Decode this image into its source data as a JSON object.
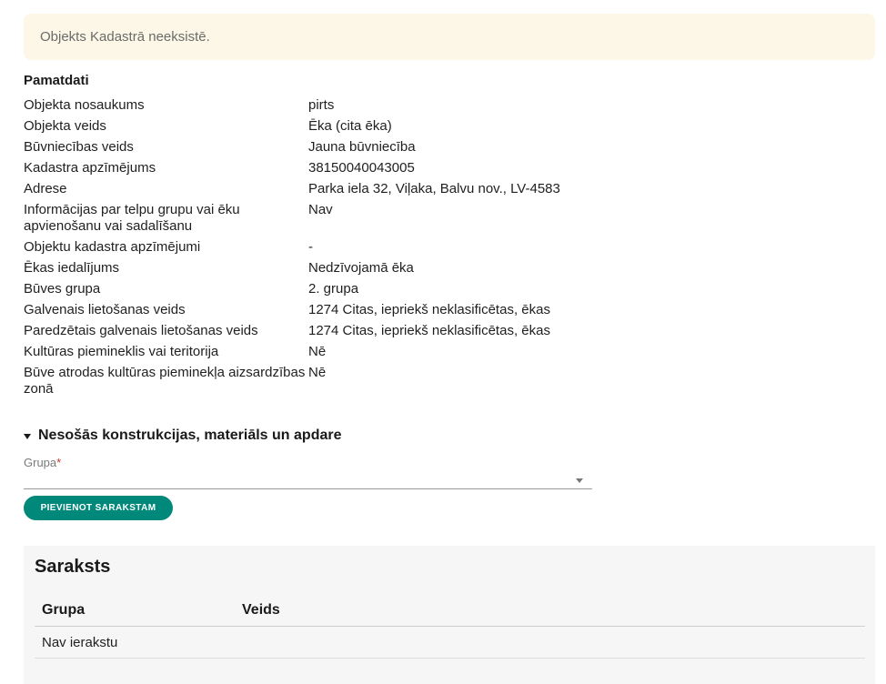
{
  "alert": {
    "message": "Objekts Kadastrā neeksistē."
  },
  "basic": {
    "title": "Pamatdati",
    "rows": [
      {
        "label": "Objekta nosaukums",
        "value": "pirts"
      },
      {
        "label": "Objekta veids",
        "value": "Ēka (cita ēka)"
      },
      {
        "label": "Būvniecības veids",
        "value": "Jauna būvniecība"
      },
      {
        "label": "Kadastra apzīmējums",
        "value": "38150040043005"
      },
      {
        "label": "Adrese",
        "value": "Parka iela 32, Viļaka, Balvu nov., LV-4583"
      },
      {
        "label": "Informācijas par telpu grupu vai ēku apvienošanu vai sadalīšanu",
        "value": "Nav"
      },
      {
        "label": "Objektu kadastra apzīmējumi",
        "value": "-"
      },
      {
        "label": "Ēkas iedalījums",
        "value": "Nedzīvojamā ēka"
      },
      {
        "label": "Būves grupa",
        "value": "2. grupa"
      },
      {
        "label": "Galvenais lietošanas veids",
        "value": "1274 Citas, iepriekš neklasificētas, ēkas"
      },
      {
        "label": "Paredzētais galvenais lietošanas veids",
        "value": "1274 Citas, iepriekš neklasificētas, ēkas"
      },
      {
        "label": "Kultūras piemineklis vai teritorija",
        "value": "Nē"
      },
      {
        "label": "Būve atrodas kultūras pieminekļa aizsardzības zonā",
        "value": "Nē"
      }
    ]
  },
  "constructions": {
    "title": "Nesošās konstrukcijas, materiāls un apdare",
    "group_label": "Grupa",
    "required_mark": "*",
    "group_value": "",
    "add_button": "PIEVIENOT SARAKSTAM"
  },
  "list": {
    "title": "Saraksts",
    "columns": [
      "Grupa",
      "Veids"
    ],
    "empty_text": "Nav ierakstu"
  }
}
